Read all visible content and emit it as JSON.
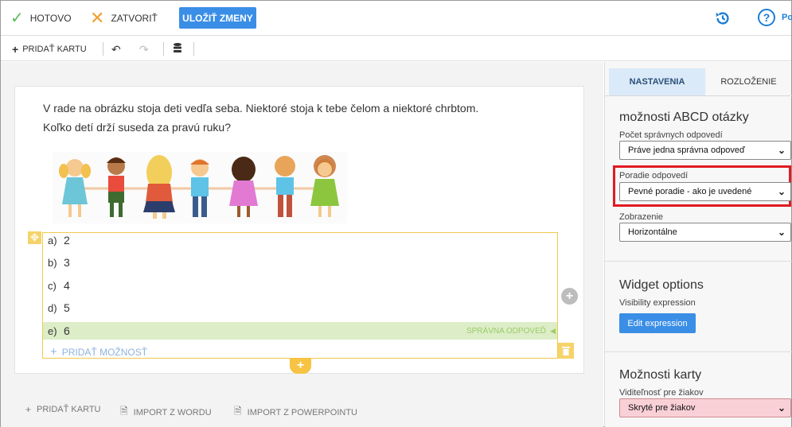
{
  "topbar": {
    "done_label": "HOTOVO",
    "close_label": "ZATVORIŤ",
    "save_label": "ULOŽIŤ ZMENY",
    "help_label": "Po"
  },
  "toolbar2": {
    "add_card_label": "PRIDAŤ KARTU"
  },
  "card": {
    "question_lines": [
      "V rade na obrázku stoja deti vedľa seba. Niektoré stoja k tebe čelom a niektoré chrbtom.",
      "Koľko detí drží suseda za pravú ruku?"
    ],
    "answers": [
      {
        "letter": "a)",
        "text": "2"
      },
      {
        "letter": "b)",
        "text": "3"
      },
      {
        "letter": "c)",
        "text": "4"
      },
      {
        "letter": "d)",
        "text": "5"
      },
      {
        "letter": "e)",
        "text": "6"
      }
    ],
    "correct_label": "SPRÁVNA ODPOVEĎ",
    "add_option_label": "PRIDAŤ MOŽNOSŤ"
  },
  "bottom": {
    "add_card_label": "PRIDAŤ KARTU",
    "import_word_label": "IMPORT Z WORDU",
    "import_ppt_label": "IMPORT Z POWERPOINTU"
  },
  "panel": {
    "tab_settings": "NASTAVENIA",
    "tab_layout": "ROZLOŽENIE",
    "section1_title": "možnosti ABCD otázky",
    "correct_count_label": "Počet správnych odpovedí",
    "correct_count_value": "Práve jedna správna odpoveď",
    "order_label": "Poradie odpovedí",
    "order_value": "Pevné poradie - ako je uvedené",
    "display_label": "Zobrazenie",
    "display_value": "Horizontálne",
    "section2_title": "Widget options",
    "visibility_label": "Visibility expression",
    "edit_expression_label": "Edit expression",
    "section3_title": "Možnosti karty",
    "student_visibility_label": "Viditeľnosť pre žiakov",
    "student_visibility_value": "Skryté pre žiakov"
  },
  "colors": {
    "accent": "#3a8ee6",
    "correct_bg": "#dcedc8",
    "answers_border": "#f2c94c",
    "highlight": "#e21a22",
    "hidden_bg": "#f9d0d6"
  }
}
